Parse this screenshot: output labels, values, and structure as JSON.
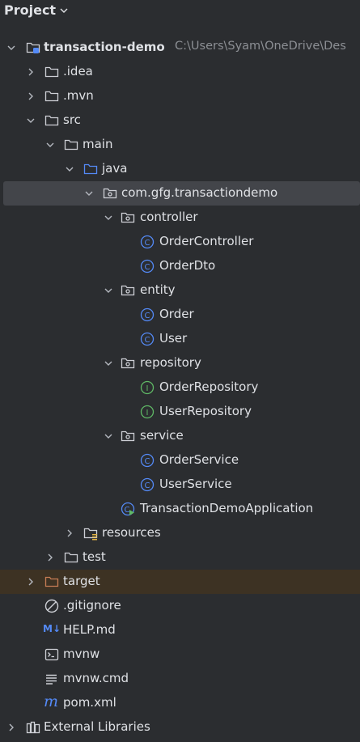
{
  "panel": {
    "title": "Project"
  },
  "tree": {
    "root": {
      "name": "transaction-demo",
      "path": "C:\\Users\\Syam\\OneDrive\\Des"
    },
    "idea": ".idea",
    "mvn": ".mvn",
    "src": "src",
    "main": "main",
    "java": "java",
    "package": "com.gfg.transactiondemo",
    "controller": "controller",
    "order_controller": "OrderController",
    "order_dto": "OrderDto",
    "entity": "entity",
    "order": "Order",
    "user": "User",
    "repository": "repository",
    "order_repository": "OrderRepository",
    "user_repository": "UserRepository",
    "service": "service",
    "order_service": "OrderService",
    "user_service": "UserService",
    "application": "TransactionDemoApplication",
    "resources": "resources",
    "test": "test",
    "target": "target",
    "gitignore": ".gitignore",
    "help": "HELP.md",
    "mvnw": "mvnw",
    "mvnw_cmd": "mvnw.cmd",
    "pom": "pom.xml",
    "external_libraries": "External Libraries"
  },
  "icon_glyphs": {
    "class": "C",
    "interface": "I",
    "markdown": "M↓"
  },
  "colors": {
    "background": "#2b2d30",
    "selected_row": "#43454a",
    "excluded_row": "#3d3223",
    "class_icon": "#548af7",
    "interface_icon": "#5fb865",
    "source_folder": "#548af7",
    "excluded_folder": "#c77d55"
  }
}
